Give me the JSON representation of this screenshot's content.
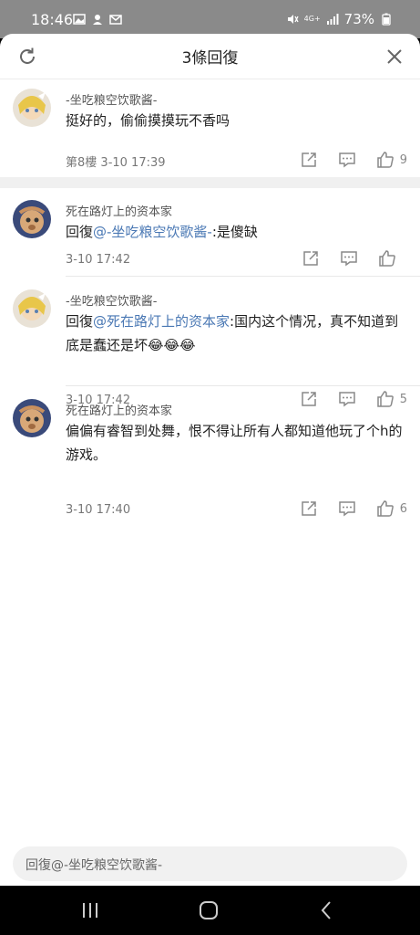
{
  "status_bar": {
    "time": "18:46",
    "network": "4G+",
    "battery": "73%"
  },
  "header": {
    "title": "3條回復"
  },
  "comments": [
    {
      "author": "-坐吃粮空饮歌酱-",
      "text": "挺好的，偷偷摸摸玩不香吗",
      "floor": "第8樓",
      "time": "3-10 17:39",
      "likes": "9"
    },
    {
      "author": "死在路灯上的资本家",
      "reply_prefix": "回復",
      "mention": "@-坐吃粮空饮歌酱-",
      "text": ":是傻缺",
      "time": "3-10 17:42",
      "likes": ""
    },
    {
      "author": "-坐吃粮空饮歌酱-",
      "reply_prefix": "回復",
      "mention": "@死在路灯上的资本家",
      "text": ":国内这个情况，真不知道到底是蠢还是坏😂😂😂",
      "time": "3-10 17:42",
      "likes": "5"
    },
    {
      "author": "死在路灯上的资本家",
      "text": "偏偏有睿智到处舞，恨不得让所有人都知道他玩了个h的游戏。",
      "time": "3-10 17:40",
      "likes": "6"
    }
  ],
  "reply_input": {
    "placeholder": "回復@-坐吃粮空饮歌酱-"
  },
  "colors": {
    "mention": "#4a78b4",
    "status_bar": "#8a8a8a",
    "divider": "#f0f0f0"
  }
}
